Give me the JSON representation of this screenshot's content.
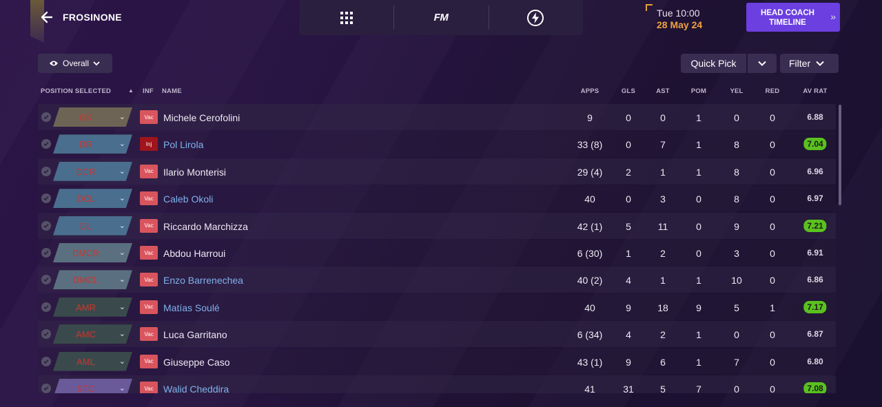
{
  "header": {
    "club_name": "FROSINONE",
    "date_time": "Tue 10:00",
    "date_day": "28 May 24",
    "head_coach_label": "HEAD COACH\nTIMELINE",
    "fm_logo": "FM"
  },
  "toolbar": {
    "view_label": "Overall",
    "quick_pick_label": "Quick Pick",
    "filter_label": "Filter"
  },
  "table": {
    "columns": {
      "position": "POSITION SELECTED",
      "inf": "INF",
      "name": "NAME",
      "apps": "APPS",
      "gls": "GLS",
      "ast": "AST",
      "pom": "POM",
      "yel": "YEL",
      "red": "RED",
      "avrat": "AV RAT"
    },
    "rows": [
      {
        "position": "GK",
        "pos_color": "#6e6455",
        "status": "Vac",
        "name": "Michele Cerofolini",
        "link": false,
        "apps": "9",
        "gls": "0",
        "ast": "0",
        "pom": "1",
        "yel": "0",
        "red": "0",
        "avrat": "6.88",
        "hi": false
      },
      {
        "position": "DR",
        "pos_color": "#4a6e8e",
        "status": "Inj",
        "name": "Pol Lirola",
        "link": true,
        "apps": "33 (8)",
        "gls": "0",
        "ast": "7",
        "pom": "1",
        "yel": "8",
        "red": "0",
        "avrat": "7.04",
        "hi": true
      },
      {
        "position": "DCR",
        "pos_color": "#4a6e8e",
        "status": "Vac",
        "name": "Ilario Monterisi",
        "link": false,
        "apps": "29 (4)",
        "gls": "2",
        "ast": "1",
        "pom": "1",
        "yel": "8",
        "red": "0",
        "avrat": "6.96",
        "hi": false
      },
      {
        "position": "DCL",
        "pos_color": "#4a6e8e",
        "status": "Vac",
        "name": "Caleb Okoli",
        "link": true,
        "apps": "40",
        "gls": "0",
        "ast": "3",
        "pom": "0",
        "yel": "8",
        "red": "0",
        "avrat": "6.97",
        "hi": false
      },
      {
        "position": "DL",
        "pos_color": "#4a6e8e",
        "status": "Vac",
        "name": "Riccardo Marchizza",
        "link": false,
        "apps": "42 (1)",
        "gls": "5",
        "ast": "11",
        "pom": "0",
        "yel": "9",
        "red": "0",
        "avrat": "7.21",
        "hi": true
      },
      {
        "position": "DMCR",
        "pos_color": "#5a7080",
        "status": "Vac",
        "name": "Abdou Harroui",
        "link": false,
        "apps": "6 (30)",
        "gls": "1",
        "ast": "2",
        "pom": "0",
        "yel": "3",
        "red": "0",
        "avrat": "6.91",
        "hi": false
      },
      {
        "position": "DMCL",
        "pos_color": "#5a7080",
        "status": "Vac",
        "name": "Enzo Barrenechea",
        "link": true,
        "apps": "40 (2)",
        "gls": "4",
        "ast": "1",
        "pom": "1",
        "yel": "10",
        "red": "0",
        "avrat": "6.86",
        "hi": false
      },
      {
        "position": "AMR",
        "pos_color": "#3a4a4c",
        "status": "Vac",
        "name": "Matías Soulé",
        "link": true,
        "apps": "40",
        "gls": "9",
        "ast": "18",
        "pom": "9",
        "yel": "5",
        "red": "1",
        "avrat": "7.17",
        "hi": true
      },
      {
        "position": "AMC",
        "pos_color": "#3a4a4c",
        "status": "Vac",
        "name": "Luca Garritano",
        "link": false,
        "apps": "6 (34)",
        "gls": "4",
        "ast": "2",
        "pom": "1",
        "yel": "0",
        "red": "0",
        "avrat": "6.87",
        "hi": false
      },
      {
        "position": "AML",
        "pos_color": "#3a4a4c",
        "status": "Vac",
        "name": "Giuseppe Caso",
        "link": false,
        "apps": "43 (1)",
        "gls": "9",
        "ast": "6",
        "pom": "1",
        "yel": "7",
        "red": "0",
        "avrat": "6.80",
        "hi": false
      },
      {
        "position": "STC",
        "pos_color": "#6a5a9a",
        "status": "Vac",
        "name": "Walid Cheddira",
        "link": true,
        "apps": "41",
        "gls": "31",
        "ast": "5",
        "pom": "7",
        "yel": "0",
        "red": "0",
        "avrat": "7.08",
        "hi": true
      }
    ]
  },
  "colors": {
    "accent": "#6b3fe0",
    "date_orange": "#f0a23c",
    "link_blue": "#7fb2ec",
    "rating_green": "#5ac11e"
  }
}
